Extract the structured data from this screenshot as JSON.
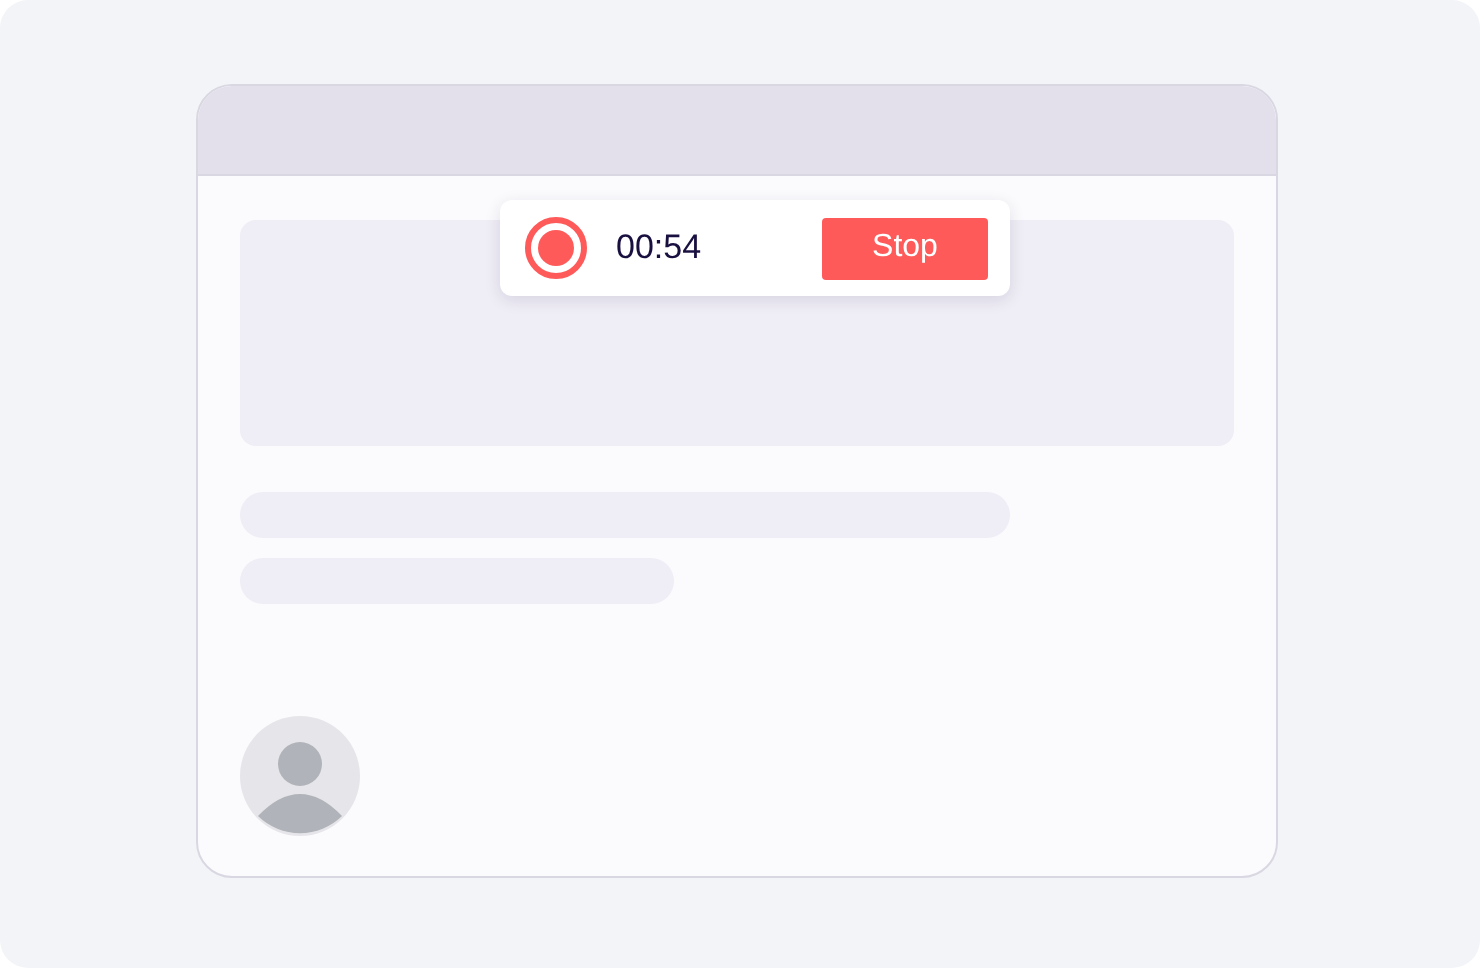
{
  "recorder": {
    "time": "00:54",
    "stop_label": "Stop"
  }
}
